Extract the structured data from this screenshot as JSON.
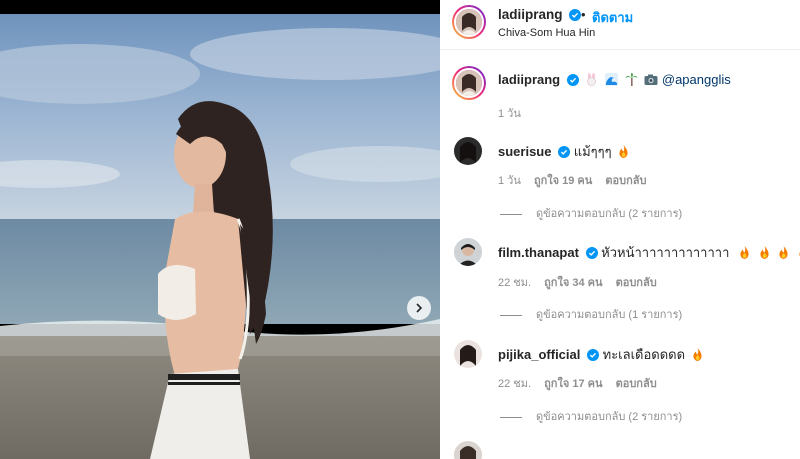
{
  "post": {
    "author": "ladiiprang",
    "follow_label": "ติดตาม",
    "dot": "•",
    "location": "Chiva-Som Hua Hin"
  },
  "caption": {
    "author": "ladiiprang",
    "mention": "@apangglis",
    "emoji_icons": [
      "rabbit-icon",
      "wave-icon",
      "palm-tree-icon",
      "camera-icon"
    ],
    "time": "1 วัน"
  },
  "comments": [
    {
      "username": "suerisue",
      "text": "แม้ๆๆๆ",
      "emoji_icons": [
        "fire-icon"
      ],
      "time": "1 วัน",
      "likes": "ถูกใจ 19 คน",
      "reply_label": "ตอบกลับ",
      "view_replies": "ดูข้อความตอบกลับ (2 รายการ)"
    },
    {
      "username": "film.thanapat",
      "text": "หัวหน้าาาาาาาาาาาาา",
      "emoji_icons": [
        "fire-icon",
        "fire-icon",
        "fire-icon",
        "fire-icon",
        "fire-icon"
      ],
      "time": "22 ชม.",
      "likes": "ถูกใจ 34 คน",
      "reply_label": "ตอบกลับ",
      "view_replies": "ดูข้อความตอบกลับ (1 รายการ)"
    },
    {
      "username": "pijika_official",
      "text": "ทะเลเดือดดดด",
      "emoji_icons": [
        "fire-icon"
      ],
      "time": "22 ชม.",
      "likes": "ถูกใจ 17 คน",
      "reply_label": "ตอบกลับ",
      "view_replies": "ดูข้อความตอบกลับ (2 รายการ)"
    }
  ],
  "colors": {
    "link_blue": "#0095f6",
    "verified_blue": "#0095f6",
    "muted_text": "#8e8e8e"
  }
}
